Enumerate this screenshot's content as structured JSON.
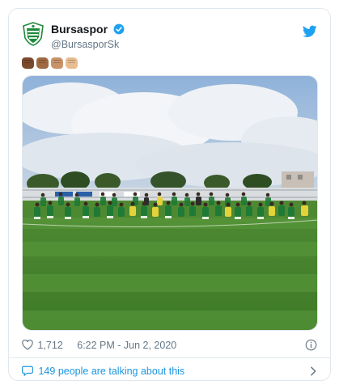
{
  "account": {
    "display_name": "Bursaspor",
    "handle": "@BursasporSk",
    "verified": true
  },
  "tweet": {
    "emoji_icons": [
      "raised-fist-dark-skin-icon",
      "raised-fist-medium-dark-skin-icon",
      "raised-fist-medium-skin-icon",
      "raised-fist-light-skin-icon"
    ],
    "emoji_colors": [
      "#7b4a2e",
      "#a06a42",
      "#c9936a",
      "#e8bd91"
    ],
    "media_description_icon": "team-photo-kneeling"
  },
  "meta": {
    "like_count": "1,712",
    "timestamp": "6:22 PM - Jun 2, 2020"
  },
  "conversation": {
    "label": "149 people are talking about this"
  },
  "colors": {
    "brand_blue": "#1da1f2",
    "link_blue": "#1b95e0",
    "secondary_text": "#657786",
    "bursaspor_green": "#1f8a3c"
  }
}
